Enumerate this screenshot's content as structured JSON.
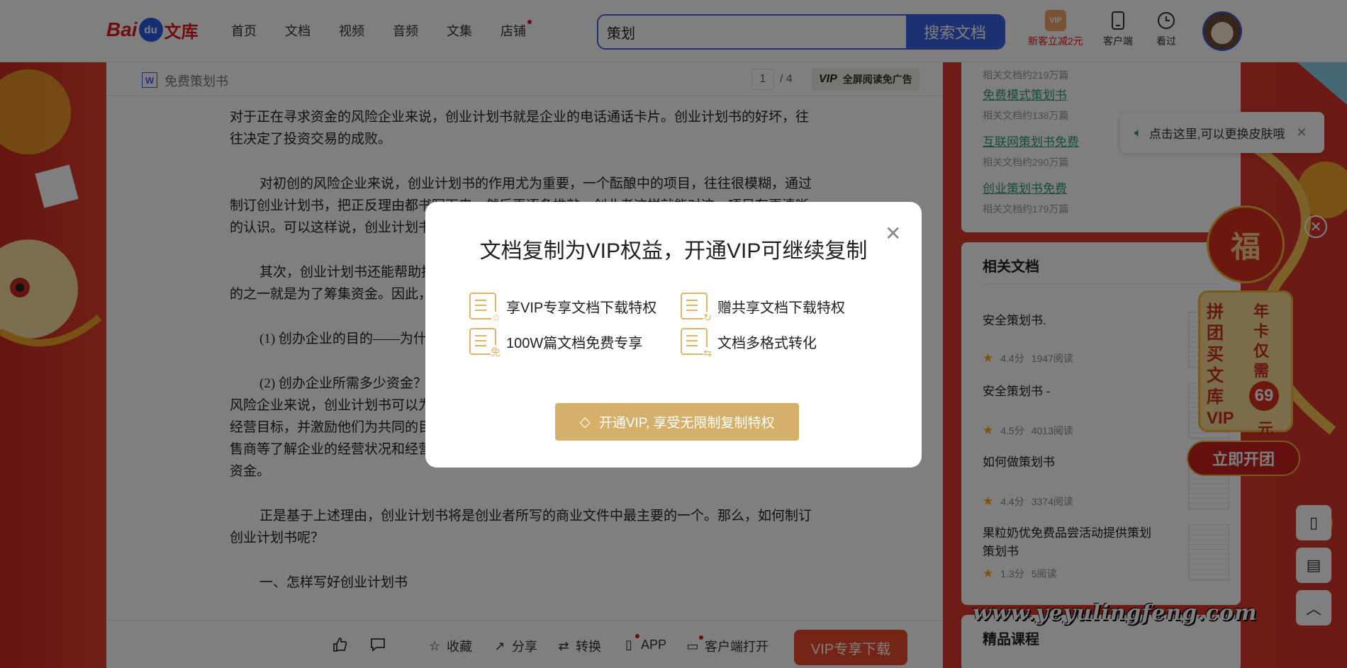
{
  "colors": {
    "brand_red": "#e0161e",
    "search_blue": "#3b62e5",
    "vip_gold": "#d4b06b",
    "link_green": "#2f9a6a"
  },
  "header": {
    "logo": {
      "bai": "Bai",
      "du": "du",
      "wenku": "文库"
    },
    "nav": [
      "首页",
      "文档",
      "视频",
      "音频",
      "文集",
      "店铺"
    ],
    "search": {
      "value": "策划",
      "button": "搜索文档"
    },
    "vip_promo": "新客立减2元",
    "vip_badge": "VIP",
    "client": "客户端",
    "history": "看过"
  },
  "doc": {
    "type_icon": "W",
    "title": "免费策划书",
    "page_current": "1",
    "page_total": "/ 4",
    "fullread": "全屏阅读免广告",
    "fullread_mark": "VIP",
    "paragraphs": [
      "对于正在寻求资金的风险企业来说，创业计划书就是企业的电话通话卡片。创业计划书的好坏，往往决定了投资交易的成败。",
      "对初创的风险企业来说，创业计划书的作用尤为重要，一个酝酿中的项目，往往很模糊，通过制订创业计划书，把正反理由都书写下来，然后再逐条推敲，创业者这样就能对这一项目有更清晰的认识。可以这样说，创业计划书首先是把计划中要创立的企业推销给了创业者自己。",
      "其次，创业计划书还能帮助把计划中的风险企业推销给风险投资家，公司创业计划书的主要目的之一就是为了筹集资金。因此，创业计划书必须要说明：",
      "(1) 创办企业的目的——为什么要冒风险，花精力、时间、资源、资金去创办风险企业？",
      "(2) 创办企业所需多少资金？为什么要这么多的钱？为什么投资人值得为此注入资金？对已建的风险企业来说，创业计划书可以为企业的发展定下比较具体的方向和重点，从而使员工了解企业的经营目标，并激励他们为共同的目标而努力。更重要的是，它可以使企业的出资者以及供应商、销售商等了解企业的经营状况和经营目标，说服出资者（原有的或新来的）为企业的进一步发展提供资金。",
      "正是基于上述理由，创业计划书将是创业者所写的商业文件中最主要的一个。那么，如何制订创业计划书呢？",
      "一、怎样写好创业计划书"
    ],
    "footer": {
      "like": "",
      "comment": "",
      "collect": "收藏",
      "share": "分享",
      "convert": "转换",
      "app": "APP",
      "client_open": "客户端打开",
      "vip_download": "VIP专享下载"
    }
  },
  "sidebar": {
    "search_links": [
      {
        "sub": "相关文档约219万篇"
      },
      {
        "title": "免费模式策划书",
        "sub": "相关文档约138万篇"
      },
      {
        "title": "互联网策划书免费",
        "sub": "相关文档约290万篇"
      },
      {
        "title": "创业策划书免费",
        "sub": "相关文档约179万篇"
      }
    ],
    "related_heading": "相关文档",
    "related": [
      {
        "title": "安全策划书.",
        "score": "4.4分",
        "reads": "1947阅读"
      },
      {
        "title": "安全策划书 -",
        "score": "4.5分",
        "reads": "4013阅读"
      },
      {
        "title": "如何做策划书",
        "score": "4.4分",
        "reads": "3374阅读"
      },
      {
        "title": "果粒奶优免费品尝活动提供策划策划书",
        "score": "1.3分",
        "reads": "5阅读"
      }
    ],
    "course_heading": "精品课程"
  },
  "toast": {
    "text": "点击这里,可以更换皮肤哦"
  },
  "promo": {
    "bag_char": "福",
    "col1": "拼团买文库VIP",
    "col2": "年卡仅需",
    "price": "69",
    "unit": "元",
    "button": "立即开团"
  },
  "watermark": "www.yeyulingfeng.com",
  "modal": {
    "title": "文档复制为VIP权益，开通VIP可继续复制",
    "perks": [
      {
        "label": "享VIP专享文档下载特权",
        "icon": "star-doc-icon",
        "mark": "☆"
      },
      {
        "label": "赠共享文档下载特权",
        "icon": "share-doc-icon",
        "mark": "↻"
      },
      {
        "label": "100W篇文档免费专享",
        "icon": "free-doc-icon",
        "mark": "免"
      },
      {
        "label": "文档多格式转化",
        "icon": "convert-doc-icon",
        "mark": "⇆"
      }
    ],
    "cta": "开通VIP, 享受无限制复制特权"
  }
}
